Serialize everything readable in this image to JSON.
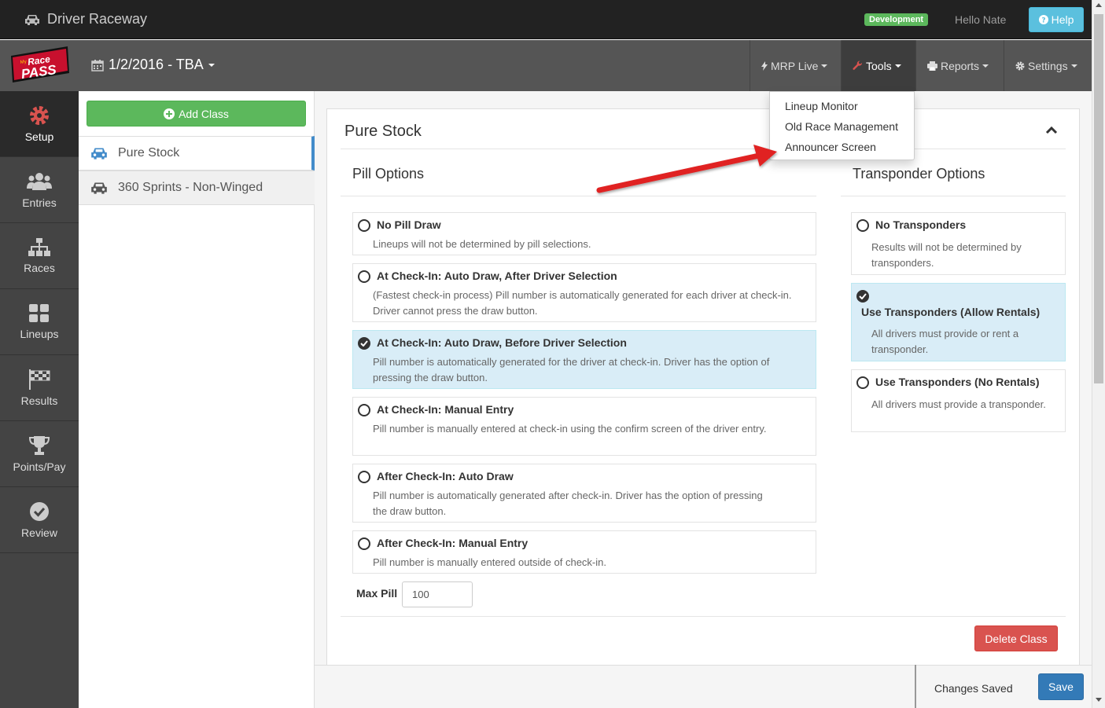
{
  "topbar": {
    "app_title": "Driver Raceway",
    "env_badge": "Development",
    "greeting": "Hello Nate",
    "help_label": "Help"
  },
  "navbar": {
    "logo_alt": "MyRacePass",
    "date_label": "1/2/2016 - TBA",
    "items": [
      {
        "label": "MRP Live",
        "icon": "bolt-icon"
      },
      {
        "label": "Tools",
        "icon": "wrench-icon"
      },
      {
        "label": "Reports",
        "icon": "print-icon"
      },
      {
        "label": "Settings",
        "icon": "gear-icon"
      }
    ]
  },
  "tools_menu": {
    "items": [
      "Lineup Monitor",
      "Old Race Management",
      "Announcer Screen"
    ]
  },
  "sidebar": {
    "items": [
      {
        "label": "Setup",
        "icon": "gear-icon",
        "active": true
      },
      {
        "label": "Entries",
        "icon": "users-icon"
      },
      {
        "label": "Races",
        "icon": "sitemap-icon"
      },
      {
        "label": "Lineups",
        "icon": "grid-icon"
      },
      {
        "label": "Results",
        "icon": "flag-icon"
      },
      {
        "label": "Points/Pay",
        "icon": "trophy-icon"
      },
      {
        "label": "Review",
        "icon": "check-circle-icon"
      }
    ]
  },
  "classes": {
    "add_label": "Add Class",
    "items": [
      {
        "label": "Pure Stock",
        "active": true
      },
      {
        "label": "360 Sprints - Non-Winged",
        "active": false
      }
    ]
  },
  "panel": {
    "title": "Pure Stock",
    "pill_title": "Pill Options",
    "pill_options": [
      {
        "title": "No Pill Draw",
        "desc": "Lineups will not be determined by pill selections."
      },
      {
        "title": "At Check-In: Auto Draw, After Driver Selection",
        "desc": "(Fastest check-in process) Pill number is automatically generated for each driver at check-in. Driver cannot press the draw button."
      },
      {
        "title": "At Check-In: Auto Draw, Before Driver Selection",
        "desc": "Pill number is automatically generated for the driver at check-in. Driver has the option of pressing the draw button.",
        "selected": true
      },
      {
        "title": "At Check-In: Manual Entry",
        "desc": "Pill number is manually entered at check-in using the confirm screen of the driver entry."
      },
      {
        "title": "After Check-In: Auto Draw",
        "desc": "Pill number is automatically generated after check-in. Driver has the option of pressing the draw button."
      },
      {
        "title": "After Check-In: Manual Entry",
        "desc": "Pill number is manually entered outside of check-in."
      }
    ],
    "max_pill_label": "Max Pill",
    "max_pill_value": "100",
    "transponder_title": "Transponder Options",
    "transponder_options": [
      {
        "title": "No Transponders",
        "desc": "Results will not be determined by transponders."
      },
      {
        "title": "Use Transponders (Allow Rentals)",
        "desc": "All drivers must provide or rent a transponder.",
        "selected": true
      },
      {
        "title": "Use Transponders (No Rentals)",
        "desc": "All drivers must provide a transponder."
      }
    ],
    "delete_label": "Delete Class"
  },
  "footer": {
    "status": "Changes Saved",
    "save_label": "Save"
  },
  "colors": {
    "accent_green": "#5cb85c",
    "accent_blue": "#337ab7",
    "danger": "#d9534f",
    "selected_bg": "#d9edf7",
    "arrow_red": "#e02020"
  }
}
